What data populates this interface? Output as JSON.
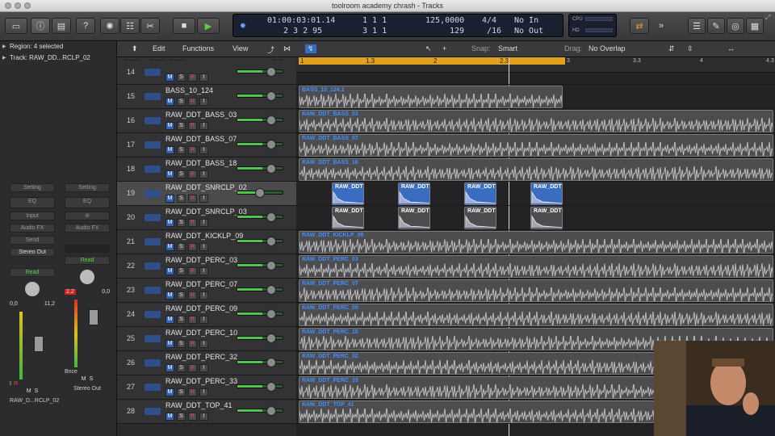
{
  "window": {
    "title": "toolroom academy chrash - Tracks"
  },
  "lcd": {
    "position_time": "01:00:03:01.14",
    "bar_beat_time": "1 1 1",
    "position_bars": "2 3 2 95",
    "bar_beat_2": "3 1 1",
    "tempo": "125,0000",
    "tempo_sub": "129",
    "signature": "4/4",
    "division": "/16",
    "midi_in": "No In",
    "midi_out": "No Out",
    "cpu": "CPU",
    "hd": "HD"
  },
  "inspector": {
    "region_label": "Region: 4 selected",
    "track_label": "Track:  RAW_DD...RCLP_02",
    "strip_left": {
      "setting": "Setting",
      "eq": "EQ",
      "input": "Input",
      "audio_fx": "Audio FX",
      "send": "Send",
      "output": "Stereo Out",
      "mode": "Read",
      "val1": "0,0",
      "val2": "11,2",
      "m": "M",
      "s": "S",
      "name": "RAW_D...RCLP_02",
      "i": "I",
      "r": "R"
    },
    "strip_right": {
      "setting": "Setting",
      "eq": "EQ",
      "audio_fx": "Audio FX",
      "mode": "Read",
      "val1": "2,2",
      "val2": "0,0",
      "bounce": "Bnce",
      "m": "M",
      "s": "S",
      "name": "Stereo Out"
    }
  },
  "menus": {
    "edit": "Edit",
    "functions": "Functions",
    "view": "View",
    "snap_label": "Snap:",
    "snap_value": "Smart",
    "drag_label": "Drag:",
    "drag_value": "No Overlap"
  },
  "trackhead": {
    "s": "S"
  },
  "ruler": {
    "ticks": [
      "1",
      "1.3",
      "2",
      "2.3",
      "3",
      "3.3",
      "4",
      "4.3"
    ]
  },
  "tracks": [
    {
      "num": "14",
      "name": ""
    },
    {
      "num": "15",
      "name": "BASS_10_124"
    },
    {
      "num": "16",
      "name": "RAW_DDT_BASS_03"
    },
    {
      "num": "17",
      "name": "RAW_DDT_BASS_07"
    },
    {
      "num": "18",
      "name": "RAW_DDT_BASS_18"
    },
    {
      "num": "19",
      "name": "RAW_DDT_SNRCLP_02"
    },
    {
      "num": "20",
      "name": "RAW_DDT_SNRCLP_03"
    },
    {
      "num": "21",
      "name": "RAW_DDT_KICKLP_09"
    },
    {
      "num": "22",
      "name": "RAW_DDT_PERC_03"
    },
    {
      "num": "23",
      "name": "RAW_DDT_PERC_07"
    },
    {
      "num": "24",
      "name": "RAW_DDT_PERC_09"
    },
    {
      "num": "25",
      "name": "RAW_DDT_PERC_10"
    },
    {
      "num": "26",
      "name": "RAW_DDT_PERC_32"
    },
    {
      "num": "27",
      "name": "RAW_DDT_PERC_33"
    },
    {
      "num": "28",
      "name": "RAW_DDT_TOP_41"
    }
  ],
  "msri": {
    "m": "M",
    "s": "S",
    "r": "R",
    "i": "I"
  },
  "regions": {
    "bass10": "BASS_10_124.1",
    "bass03": "RAW_DDT_BASS_03",
    "bass07": "RAW_DDT_BASS_07",
    "bass18": "RAW_DDT_BASS_18",
    "snr": "RAW_DDT",
    "kick09": "RAW_DDT_KICKLP_09",
    "perc03": "RAW_DDT_PERC_03",
    "perc07": "RAW_DDT_PERC_07",
    "perc09": "RAW_DDT_PERC_09",
    "perc10": "RAW_DDT_PERC_10",
    "perc32": "RAW_DDT_PERC_32",
    "perc33": "RAW_DDT_PERC_33",
    "top41": "RAW_DDT_TOP_41"
  },
  "colors": {
    "accent": "#e0a020",
    "region_label": "#3f8fff",
    "snare": "#3a6dbf"
  }
}
